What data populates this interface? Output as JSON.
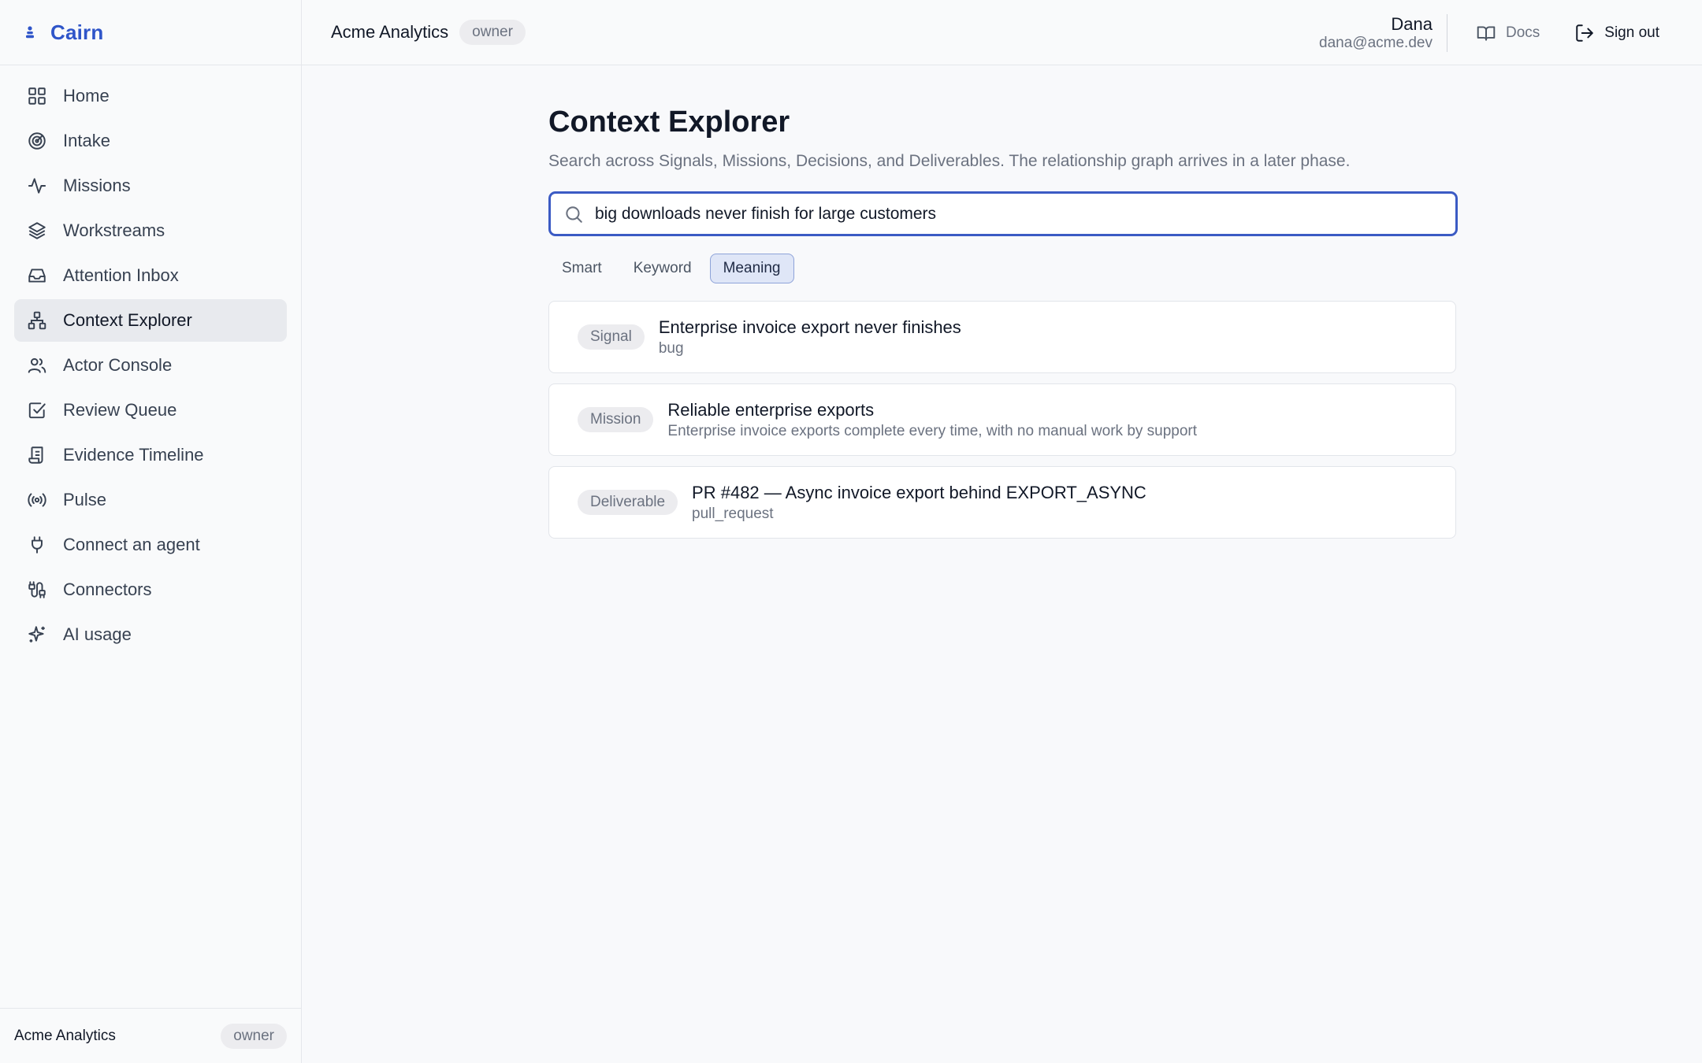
{
  "app": {
    "name": "Cairn"
  },
  "sidebar": {
    "items": [
      {
        "label": "Home",
        "icon": "home-grid-icon"
      },
      {
        "label": "Intake",
        "icon": "target-icon"
      },
      {
        "label": "Missions",
        "icon": "activity-icon"
      },
      {
        "label": "Workstreams",
        "icon": "layers-icon"
      },
      {
        "label": "Attention Inbox",
        "icon": "inbox-icon"
      },
      {
        "label": "Context Explorer",
        "icon": "network-icon",
        "active": true
      },
      {
        "label": "Actor Console",
        "icon": "users-icon"
      },
      {
        "label": "Review Queue",
        "icon": "check-square-icon"
      },
      {
        "label": "Evidence Timeline",
        "icon": "scroll-icon"
      },
      {
        "label": "Pulse",
        "icon": "radio-icon"
      },
      {
        "label": "Connect an agent",
        "icon": "plug-icon"
      },
      {
        "label": "Connectors",
        "icon": "cable-icon"
      },
      {
        "label": "AI usage",
        "icon": "sparkles-icon"
      }
    ],
    "footer": {
      "org": "Acme Analytics",
      "role": "owner"
    }
  },
  "topbar": {
    "org": "Acme Analytics",
    "role": "owner",
    "user_name": "Dana",
    "user_email": "dana@acme.dev",
    "docs_label": "Docs",
    "signout_label": "Sign out"
  },
  "main": {
    "title": "Context Explorer",
    "subtitle": "Search across Signals, Missions, Decisions, and Deliverables. The relationship graph arrives in a later phase.",
    "search": {
      "value": "big downloads never finish for large customers"
    },
    "modes": [
      {
        "label": "Smart",
        "active": false
      },
      {
        "label": "Keyword",
        "active": false
      },
      {
        "label": "Meaning",
        "active": true
      }
    ],
    "results": [
      {
        "kind": "Signal",
        "title": "Enterprise invoice export never finishes",
        "meta": "bug"
      },
      {
        "kind": "Mission",
        "title": "Reliable enterprise exports",
        "meta": "Enterprise invoice exports complete every time, with no manual work by support"
      },
      {
        "kind": "Deliverable",
        "title": "PR #482 — Async invoice export behind EXPORT_ASYNC",
        "meta": "pull_request"
      }
    ]
  },
  "colors": {
    "brand": "#2f55c9",
    "search_border": "#3b5bc4",
    "active_mode_bg": "#dfe6f7"
  }
}
